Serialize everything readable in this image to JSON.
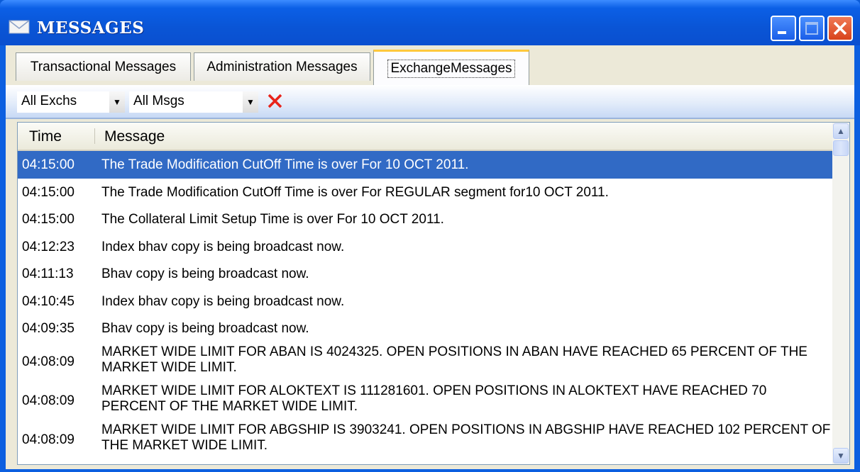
{
  "window": {
    "title": "MESSAGES",
    "icon": "envelope-icon"
  },
  "tabs": [
    {
      "label": "Transactional Messages",
      "active": false
    },
    {
      "label": "Administration Messages",
      "active": false
    },
    {
      "label": "ExchangeMessages",
      "active": true
    }
  ],
  "toolbar": {
    "exchange_filter": "All Exchs",
    "message_filter": "All Msgs",
    "clear_icon": "red-x-icon"
  },
  "grid": {
    "columns": [
      "Time",
      "Message"
    ],
    "rows": [
      {
        "time": "04:15:00",
        "message": "The Trade Modification CutOff Time is over For 10 OCT 2011."
      },
      {
        "time": "04:15:00",
        "message": "The Trade Modification CutOff Time is over For REGULAR segment for10 OCT 2011."
      },
      {
        "time": "04:15:00",
        "message": "The Collateral Limit Setup Time is over For 10 OCT 2011."
      },
      {
        "time": "04:12:23",
        "message": "Index bhav copy is being broadcast now."
      },
      {
        "time": "04:11:13",
        "message": "Bhav copy is being broadcast now."
      },
      {
        "time": "04:10:45",
        "message": "Index bhav copy is being broadcast now."
      },
      {
        "time": "04:09:35",
        "message": "Bhav copy is being broadcast now."
      },
      {
        "time": "04:08:09",
        "message": "MARKET WIDE LIMIT FOR ABAN IS 4024325. OPEN POSITIONS IN ABAN HAVE REACHED 65 PERCENT OF THE MARKET WIDE LIMIT."
      },
      {
        "time": "04:08:09",
        "message": "MARKET WIDE LIMIT FOR ALOKTEXT IS 111281601. OPEN POSITIONS IN ALOKTEXT HAVE REACHED 70 PERCENT OF THE MARKET WIDE LIMIT."
      },
      {
        "time": "04:08:09",
        "message": "MARKET WIDE LIMIT FOR ABGSHIP IS 3903241. OPEN POSITIONS IN ABGSHIP HAVE REACHED 102 PERCENT OF THE MARKET WIDE LIMIT."
      }
    ],
    "selected_row": 0
  },
  "colors": {
    "title_bar": "#0a55d6",
    "selection": "#316ac5",
    "clear_x": "#e8231a"
  }
}
